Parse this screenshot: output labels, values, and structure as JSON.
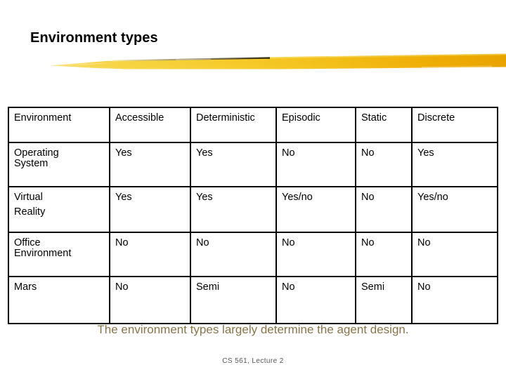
{
  "slide": {
    "title": "Environment types",
    "caption": "The environment types largely determine the agent design.",
    "footer": "CS 561, Lecture 2"
  },
  "decor": {
    "brush_stroke_name": "gold-brush-stroke",
    "color_light": "#f7d64a",
    "color_mid": "#f5c21c",
    "color_dark": "#e8a300"
  },
  "colors": {
    "title": "#000000",
    "caption": "#8a7548",
    "footer": "#555555",
    "table_border": "#000000",
    "table_background": "#ffffff"
  },
  "table": {
    "headers": [
      "Environment",
      "Accessible",
      "Deterministic",
      "Episodic",
      "Static",
      "Discrete"
    ],
    "rows": [
      {
        "name_line1": "Operating",
        "name_line2": "System",
        "cells": [
          "Yes",
          "Yes",
          "No",
          "No",
          "Yes"
        ]
      },
      {
        "name_line1": "Virtual",
        "name_line2": "Reality",
        "cells": [
          "Yes",
          "Yes",
          "Yes/no",
          "No",
          "Yes/no"
        ]
      },
      {
        "name_line1": "Office",
        "name_line2": "Environment",
        "cells": [
          "No",
          "No",
          "No",
          "No",
          "No"
        ]
      },
      {
        "name_line1": "Mars",
        "name_line2": "",
        "cells": [
          "No",
          "Semi",
          "No",
          "Semi",
          "No"
        ]
      }
    ]
  }
}
